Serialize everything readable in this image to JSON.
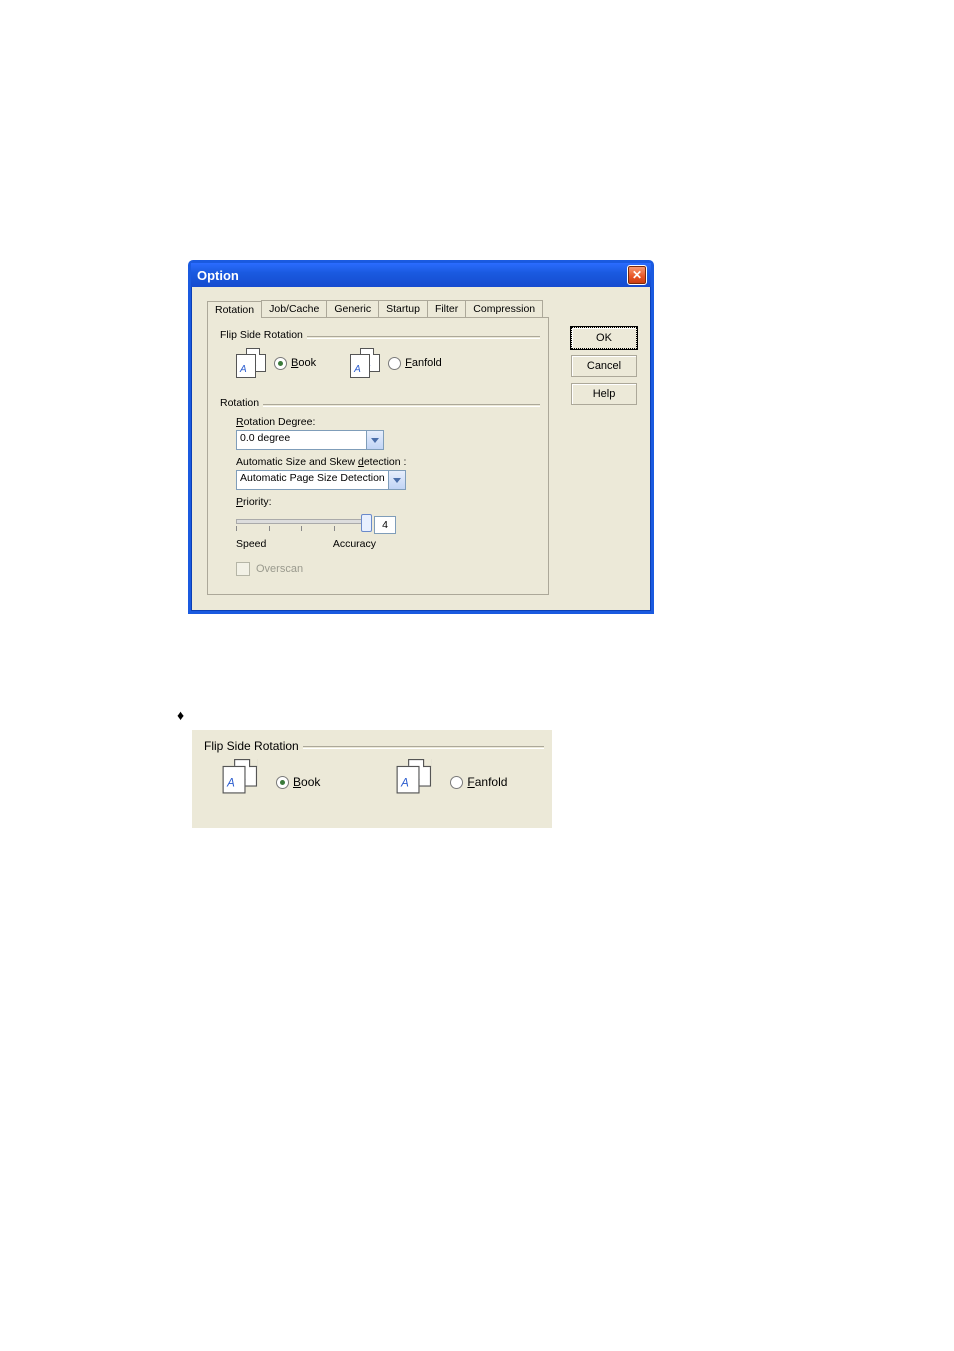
{
  "dialog": {
    "title": "Option",
    "tabs": [
      "Rotation",
      "Job/Cache",
      "Generic",
      "Startup",
      "Filter",
      "Compression"
    ],
    "active_tab": 0,
    "buttons": {
      "ok": "OK",
      "cancel": "Cancel",
      "help": "Help"
    },
    "flip_side": {
      "group_label": "Flip Side Rotation",
      "book_label": "Book",
      "fanfold_label": "Fanfold",
      "selected": "book"
    },
    "rotation": {
      "group_label": "Rotation",
      "degree_label": "Rotation Degree:",
      "degree_value": "0.0 degree",
      "autosize_label": "Automatic Size and Skew detection :",
      "autosize_value": "Automatic Page Size Detection",
      "priority_label": "Priority:",
      "priority_value": "4",
      "speed_label": "Speed",
      "accuracy_label": "Accuracy",
      "overscan_label": "Overscan",
      "overscan_checked": false
    }
  },
  "detail": {
    "bullet": "♦",
    "group_label": "Flip Side Rotation",
    "book_label": "Book",
    "fanfold_label": "Fanfold",
    "selected": "book"
  }
}
